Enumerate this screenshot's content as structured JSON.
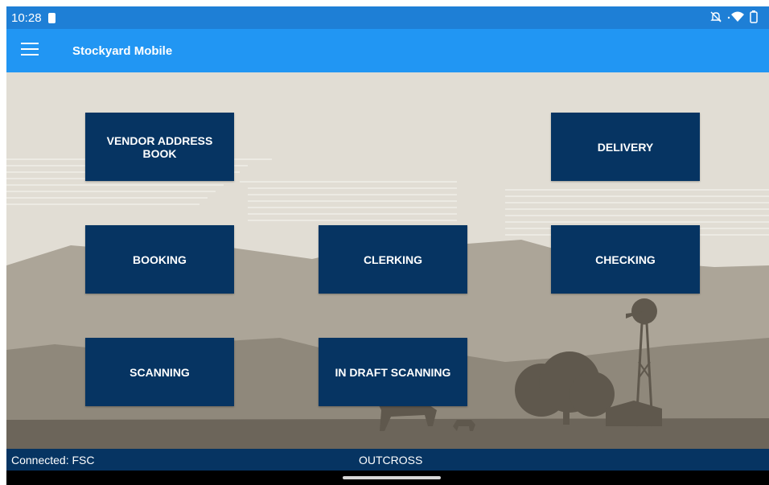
{
  "status": {
    "time": "10:28"
  },
  "app": {
    "title": "Stockyard Mobile"
  },
  "tiles": {
    "vendor_address_book": "VENDOR ADDRESS BOOK",
    "delivery": "DELIVERY",
    "booking": "BOOKING",
    "clerking": "CLERKING",
    "checking": "CHECKING",
    "scanning": "SCANNING",
    "in_draft_scanning": "IN DRAFT SCANNING"
  },
  "footer": {
    "connected": "Connected: FSC",
    "company": "OUTCROSS"
  },
  "colors": {
    "status_bar": "#1e7fd6",
    "app_bar": "#2196f3",
    "tile": "#063462",
    "background": "#e1ddd4"
  },
  "icons": [
    "sim-icon",
    "hamburger-menu-icon",
    "mute-icon",
    "wifi-icon",
    "battery-icon"
  ]
}
